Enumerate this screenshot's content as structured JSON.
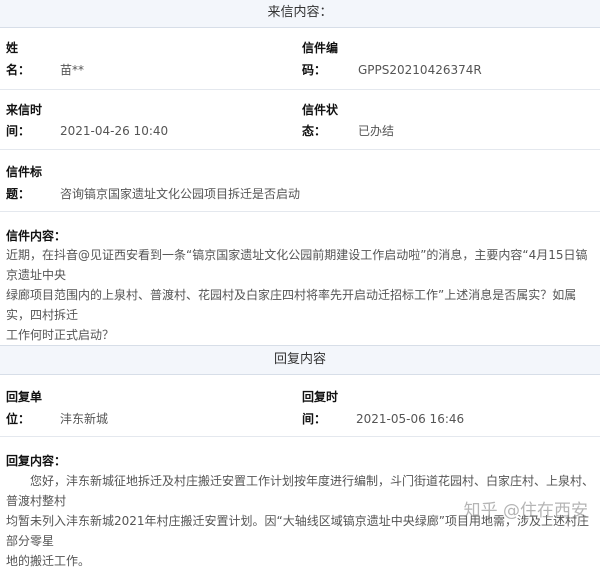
{
  "letter": {
    "section_title": "来信内容：",
    "name_label_1": "姓",
    "name_label_2": "名：",
    "name_value": "苗**",
    "code_label_1": "信件编",
    "code_label_2": "码：",
    "code_value": "GPPS20210426374R",
    "time_label_1": "来信时",
    "time_label_2": "间：",
    "time_value": "2021-04-26 10:40",
    "status_label_1": "信件状",
    "status_label_2": "态：",
    "status_value": "已办结",
    "subject_label_1": "信件标",
    "subject_label_2": "题：",
    "subject_value": "咨询镐京国家遗址文化公园项目拆迁是否启动",
    "content_label": "信件内容：",
    "content_line_1": "近期，在抖音@见证西安看到一条“镐京国家遗址文化公园前期建设工作启动啦”的消息，主要内容“4月15日镐京遗址中央",
    "content_line_2": "绿廊项目范围内的上泉村、普渡村、花园村及白家庄四村将率先开启动迁招标工作”上述消息是否属实？如属实，四村拆迁",
    "content_line_3": "工作何时正式启动？"
  },
  "reply": {
    "section_title": "回复内容",
    "unit_label_1": "回复单",
    "unit_label_2": "位：",
    "unit_value": "沣东新城",
    "time_label_1": "回复时",
    "time_label_2": "间：",
    "time_value": "2021-05-06 16:46",
    "content_label": "回复内容：",
    "content_line_1": "您好，沣东新城征地拆迁及村庄搬迁安置工作计划按年度进行编制，斗门街道花园村、白家庄村、上泉村、普渡村整村",
    "content_line_2": "均暂未列入沣东新城2021年村庄搬迁安置计划。因“大轴线区域镐京遗址中央绿廊”项目用地需，涉及上述村庄部分零星",
    "content_line_3": "地的搬迁工作。"
  },
  "watermark": "知乎 @住在西安"
}
